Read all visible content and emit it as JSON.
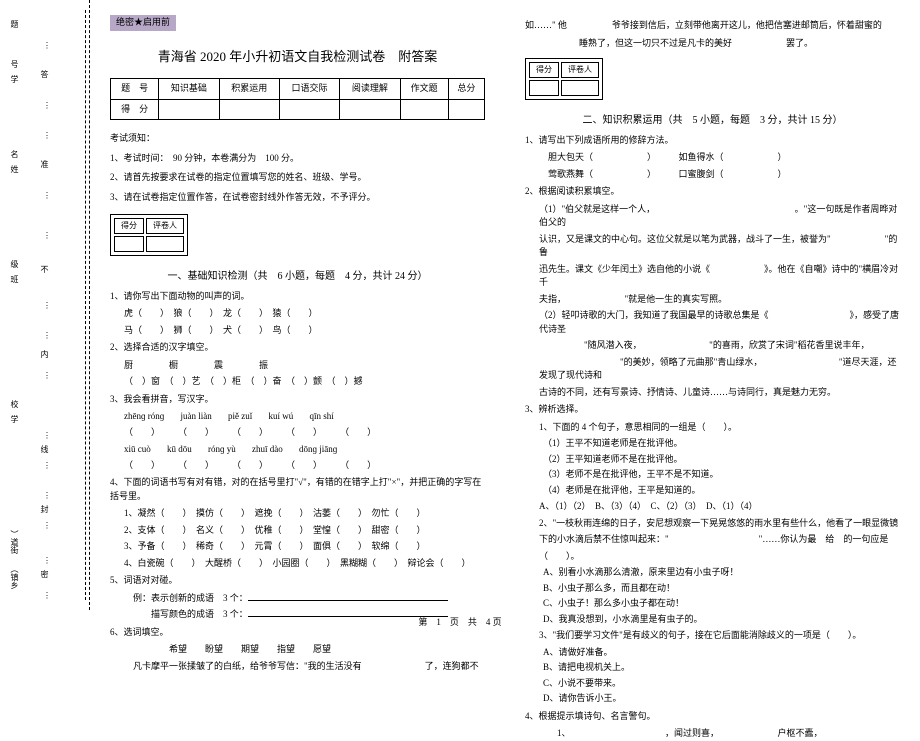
{
  "confidential": "绝密★启用前",
  "title": "青海省 2020 年小升初语文自我检测试卷　附答案",
  "scoreTable": {
    "h1": "题　号",
    "h2": "知识基础",
    "h3": "积累运用",
    "h4": "口语交际",
    "h5": "阅读理解",
    "h6": "作文题",
    "h7": "总分",
    "r2": "得　分"
  },
  "notice": {
    "hd": "考试须知：",
    "n1": "1、考试时间：　90 分钟，本卷满分为　100 分。",
    "n2": "2、请首先按要求在试卷的指定位置填写您的姓名、班级、学号。",
    "n3": "3、请在试卷指定位置作答，在试卷密封线外作答无效，不予评分。"
  },
  "scorer": {
    "c1": "得分",
    "c2": "评卷人"
  },
  "sec1": {
    "title": "一、基础知识检测（共　6 小题，每题　4 分，共计 24 分）",
    "q1": "1、请你写出下面动物的叫声的词。",
    "q1row1a": "虎（　　）　狼（　　）　龙（　　）　猿（　　）",
    "q1row1b": "马（　　）　狮（　　）　犬（　　）　鸟（　　）",
    "q2": "2、选择合适的汉字填空。",
    "q2row1": "厨　　　　橱　　　　震　　　　振",
    "q2row2": "（　）窗　（　）艺　（　）柜　（　）奋　（　）颤　（　）撼",
    "q3": "3、我会看拼音，写汉字。",
    "q3p1": {
      "a": "zhēnɡ rónɡ",
      "b": "juàn liàn",
      "c": "piě zuǐ",
      "d": "kuí wú",
      "e": "qīn shí"
    },
    "q3p2": {
      "a": "xiū cuò",
      "b": "kū dōu",
      "c": "rónɡ yù",
      "d": "zhuī dào",
      "e": "dōnɡ jiānɡ"
    },
    "q4": "4、下面的词语书写有对有错，对的在括号里打\"√\"，有错的在错字上打\"×\"，并把正确的字写在括号里。",
    "q4r1": "1、凝然（　　）　摸仿（　　）　遮挽（　　）　沽萎（　　）　勿忙（　　）",
    "q4r2": "2、支体（　　）　名义（　　）　优稚（　　）　堂惶（　　）　甜密（　　）",
    "q4r3": "3、予备（　　）　稀奇（　　）　元霄（　　）　面俱（　　）　软绵（　　）",
    "q4r4": "4、白瓷碗（　　）　大醒桥（　　）　小园圈（　　）　黑糊糊（　　）　辩论会（　　）",
    "q5": "5、词语对对碰。",
    "q5r1": "　例：表示创新的成语　3 个：",
    "q5r2": "　　　描写颜色的成语　3 个：",
    "q6": "6、选词填空。",
    "q6words": "　　　　　希望　　盼望　　期望　　指望　　愿望",
    "q6text": "　凡卡摩平一张揉皱了的白纸，给爷爷写信：\"我的生活没有　　　　　　　了，连狗都不"
  },
  "col2": {
    "cont1": "如……\" 他　　　　　爷爷接到信后，立刻带他离开这儿，他把信塞进邮筒后，怀着甜蜜的",
    "cont2": "　　　　　　睡熟了，但这一切只不过是凡卡的美好　　　　　　罢了。",
    "sec2title": "二、知识积累运用（共　5 小题，每题　3 分，共计 15 分）",
    "q1": "1、请写出下列成语所用的修辞方法。",
    "q1r1": "　胆大包天（　　　　　　）　　　如鱼得水（　　　　　　）",
    "q1r2": "　莺歌燕舞（　　　　　　）　　　口蜜腹剑（　　　　　　）",
    "q2": "2、根据阅读积累填空。",
    "q2r1": "（1）\"伯父就是这样一个人，　　　　　　　　　　　　　　　　。\"这一句既是作者周晔对伯父的",
    "q2r2": "认识，又是课文的中心句。这位父就是以笔为武器，战斗了一生，被誉为\"　　　　　　\"的鲁",
    "q2r3": "迅先生。课文《少年闰土》选自他的小说《　　　　　　》。他在《自嘲》诗中的\"横眉冷对千",
    "q2r4": "夫指，　　　　　　　\"就是他一生的真实写照。",
    "q2r5": "（2）轻叩诗歌的大门，我知道了我国最早的诗歌总集是《　　　　　　　　　》，感受了唐代诗圣",
    "q2r6": "　　　　　\"随风潜入夜，　　　　　　　　\"的喜雨，欣赏了宋词\"稻花香里说丰年，",
    "q2r7": "　　　　　　　　　\"的美妙，领略了元曲那\"青山绿水，　　　　　　　　　\"道尽天涯，还发现了现代诗和",
    "q2r8": "古诗的不同，还有写景诗、抒情诗、儿童诗……与诗同行，真是魅力无穷。",
    "q3": "3、辨析选择。",
    "q3a": "1、下面的 4 个句子，意思相同的一组是（　　）。",
    "q3a1": "（1）王平不知道老师是在批评他。",
    "q3a2": "（2）王平知道老师不是在批评他。",
    "q3a3": "（3）老师不是在批评他，王平不是不知道。",
    "q3a4": "（4）老师是在批评他，王平是知道的。",
    "q3aopts": "A、（1）（2）　B、（3）（4）　C、（2）（3）　D、（1）（4）",
    "q3b": "2、\"一枝秋雨连绵的日子，安尼想观察一下晃晃悠悠的雨水里有些什么，他看了一眼显微镜",
    "q3b2": "下的小水滴后禁不住惊叫起来：\"　　　　　　　　　　\"……你认为最　给　的一句应是",
    "q3b3": "（　　）。",
    "q3bA": "A、别看小水滴那么清澈，原来里边有小虫子呀！",
    "q3bB": "B、小虫子那么多，而且都在动！",
    "q3bC": "C、小虫子！那么多小虫子都在动！",
    "q3bD": "D、我真没想到，小水滴里是有虫子的。",
    "q3c": "3、\"我们要学习文件\"是有歧义的句子，接在它后面能消除歧义的一项是（　　）。",
    "q3cA": "A、请做好准备。",
    "q3cB": "B、请把电视机关上。",
    "q3cC": "C、小说不要带来。",
    "q3cD": "D、请你告诉小王。",
    "q4": "4、根据提示填诗句、名言警句。",
    "q4r1": "　　1、　　　　　　　　　　　，闻过则喜，　　　　　　　户枢不蠹，"
  },
  "binding": {
    "v1": "题",
    "v2": "号",
    "v3": "学",
    "v4": "名",
    "v5": "姓",
    "v6": "级",
    "v7": "班",
    "v8": "校",
    "v9": "学",
    "v10": "）道街",
    "v11": "（镇乡",
    "s1": "答",
    "s2": "准",
    "s3": "不",
    "s4": "内",
    "s5": "线",
    "s6": "封",
    "s7": "密"
  },
  "footer": "第　1　页　共　4 页"
}
